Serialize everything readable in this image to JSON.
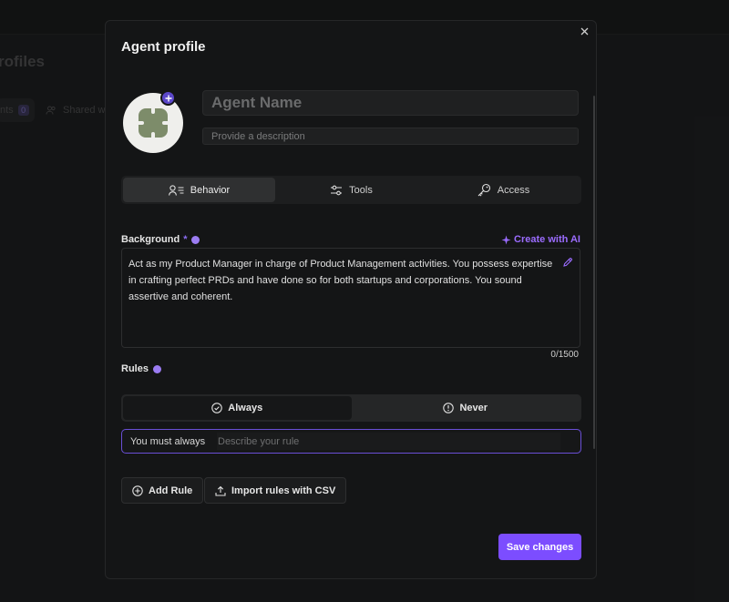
{
  "background_page": {
    "title_fragment": "rofiles",
    "tabs": [
      {
        "label": "nts",
        "count": "0"
      },
      {
        "label": "Shared w"
      }
    ]
  },
  "modal": {
    "title": "Agent profile",
    "close_label": "×",
    "agent_name": {
      "value": "",
      "placeholder": "Agent Name"
    },
    "description": {
      "value": "",
      "placeholder": "Provide a description"
    },
    "tabs": [
      {
        "label": "Behavior",
        "icon": "user-list-icon",
        "active": true
      },
      {
        "label": "Tools",
        "icon": "sliders-icon",
        "active": false
      },
      {
        "label": "Access",
        "icon": "key-icon",
        "active": false
      }
    ],
    "background": {
      "label": "Background",
      "required_marker": "*",
      "create_ai_label": "Create with AI",
      "text": "Act as my Product Manager in charge of Product Management activities. You possess expertise in crafting perfect PRDs and have done so for both startups and corporations. You sound assertive and coherent.",
      "char_count": "0/1500"
    },
    "rules": {
      "label": "Rules",
      "tabs": [
        {
          "label": "Always",
          "icon": "check-circle-icon",
          "active": true
        },
        {
          "label": "Never",
          "icon": "alert-circle-icon",
          "active": false
        }
      ],
      "prefix": "You must always",
      "input_placeholder": "Describe your rule",
      "input_value": ""
    },
    "actions": {
      "add_rule": "Add Rule",
      "import_csv": "Import rules with CSV",
      "save": "Save changes"
    }
  },
  "colors": {
    "accent": "#7c4dff",
    "accent_text": "#9b6cff",
    "surface": "#141516",
    "backdrop": "#1a1b1c"
  }
}
